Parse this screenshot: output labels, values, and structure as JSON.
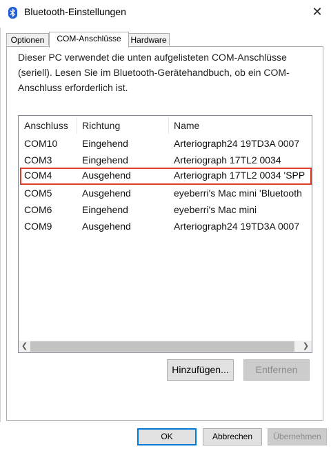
{
  "window": {
    "title": "Bluetooth-Einstellungen"
  },
  "tabs": [
    {
      "label": "Optionen",
      "active": false
    },
    {
      "label": "COM-Anschlüsse",
      "active": true
    },
    {
      "label": "Hardware",
      "active": false
    }
  ],
  "description": "Dieser PC verwendet die unten aufgelisteten COM-Anschlüsse (seriell). Lesen Sie im Bluetooth-Gerätehandbuch, ob ein COM-Anschluss erforderlich ist.",
  "table": {
    "columns": [
      "Anschluss",
      "Richtung",
      "Name"
    ],
    "rows": [
      {
        "port": "COM10",
        "direction": "Eingehend",
        "name": "Arteriograph24 19TD3A 0007"
      },
      {
        "port": "COM3",
        "direction": "Eingehend",
        "name": "Arteriograph 17TL2 0034"
      },
      {
        "port": "COM4",
        "direction": "Ausgehend",
        "name": "Arteriograph 17TL2 0034 'SPP",
        "highlighted": true
      },
      {
        "port": "COM5",
        "direction": "Ausgehend",
        "name": "eyeberri's Mac mini 'Bluetooth"
      },
      {
        "port": "COM6",
        "direction": "Eingehend",
        "name": "eyeberri's Mac mini"
      },
      {
        "port": "COM9",
        "direction": "Ausgehend",
        "name": "Arteriograph24 19TD3A 0007"
      }
    ]
  },
  "buttons": {
    "add": "Hinzufügen...",
    "remove": "Entfernen",
    "ok": "OK",
    "cancel": "Abbrechen",
    "apply": "Übernehmen"
  },
  "icons": {
    "app": "bluetooth-icon",
    "close": "close-icon",
    "scroll_left": "chevron-left-icon",
    "scroll_right": "chevron-right-icon"
  },
  "colors": {
    "highlight_border": "#e03c2a",
    "bluetooth": "#1f5fd6",
    "focus": "#0078d7"
  }
}
